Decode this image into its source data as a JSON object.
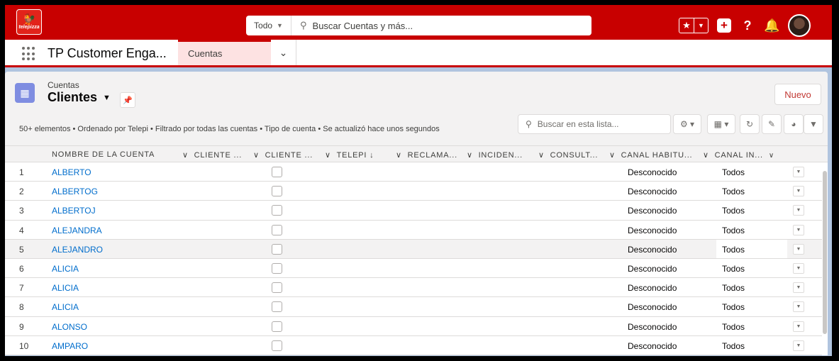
{
  "header": {
    "logo_text": "telepizza",
    "search_scope": "Todo",
    "search_placeholder": "Buscar Cuentas y más..."
  },
  "nav": {
    "app_name": "TP Customer Enga...",
    "active_tab": "Cuentas"
  },
  "list": {
    "object_label": "Cuentas",
    "view_name": "Clientes",
    "new_button": "Nuevo",
    "meta": "50+ elementos • Ordenado por Telepi • Filtrado por todas las cuentas • Tipo de cuenta • Se actualizó hace unos segundos",
    "search_placeholder": "Buscar en esta lista..."
  },
  "columns": [
    "NOMBRE DE LA CUENTA",
    "CLIENTE ...",
    "CLIENTE ...",
    "TELEPI ↓",
    "RECLAMA...",
    "INCIDEN...",
    "CONSULT...",
    "CANAL HABITU...",
    "CANAL IN..."
  ],
  "rows": [
    {
      "num": "1",
      "name": "ALBERTO",
      "canal": "Desconocido",
      "canal_in": "Todos"
    },
    {
      "num": "2",
      "name": "ALBERTOG",
      "canal": "Desconocido",
      "canal_in": "Todos"
    },
    {
      "num": "3",
      "name": "ALBERTOJ",
      "canal": "Desconocido",
      "canal_in": "Todos"
    },
    {
      "num": "4",
      "name": "ALEJANDRA",
      "canal": "Desconocido",
      "canal_in": "Todos"
    },
    {
      "num": "5",
      "name": "ALEJANDRO",
      "canal": "Desconocido",
      "canal_in": "Todos"
    },
    {
      "num": "6",
      "name": "ALICIA",
      "canal": "Desconocido",
      "canal_in": "Todos"
    },
    {
      "num": "7",
      "name": "ALICIA",
      "canal": "Desconocido",
      "canal_in": "Todos"
    },
    {
      "num": "8",
      "name": "ALICIA",
      "canal": "Desconocido",
      "canal_in": "Todos"
    },
    {
      "num": "9",
      "name": "ALONSO",
      "canal": "Desconocido",
      "canal_in": "Todos"
    },
    {
      "num": "10",
      "name": "AMPARO",
      "canal": "Desconocido",
      "canal_in": "Todos"
    }
  ],
  "colors": {
    "header_red": "#c80000",
    "link_blue": "#006dcc",
    "object_icon": "#7f8de1"
  }
}
